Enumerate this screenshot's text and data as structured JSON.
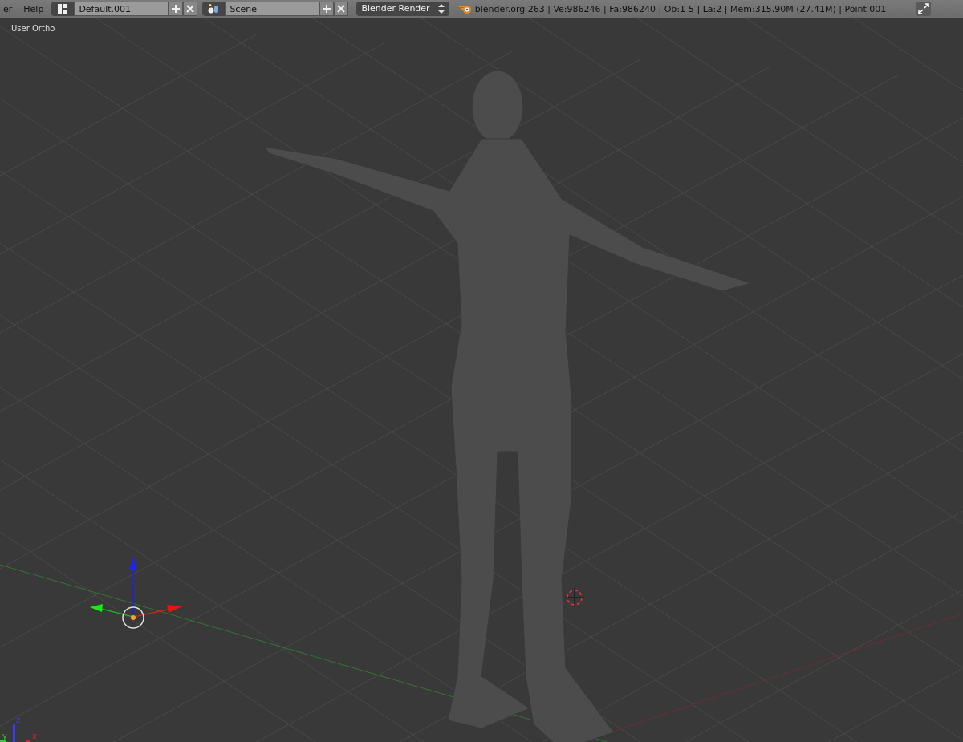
{
  "menu": [
    {
      "label": "er"
    },
    {
      "label": "Help"
    }
  ],
  "layout": {
    "name": "Default.001"
  },
  "scene": {
    "name": "Scene"
  },
  "render_engine": {
    "value": "Blender Render"
  },
  "stats": "blender.org 263 | Ve:986246 | Fa:986240 | Ob:1-5 | La:2 | Mem:315.90M (27.41M) | Point.001",
  "viewport": {
    "view_label": "User Ortho",
    "axis_labels": [
      {
        "axis": "y",
        "color": "#2ecc2e"
      },
      {
        "axis": "z",
        "color": "#3a3aff"
      },
      {
        "axis": "x",
        "color": "#e02020"
      }
    ]
  }
}
